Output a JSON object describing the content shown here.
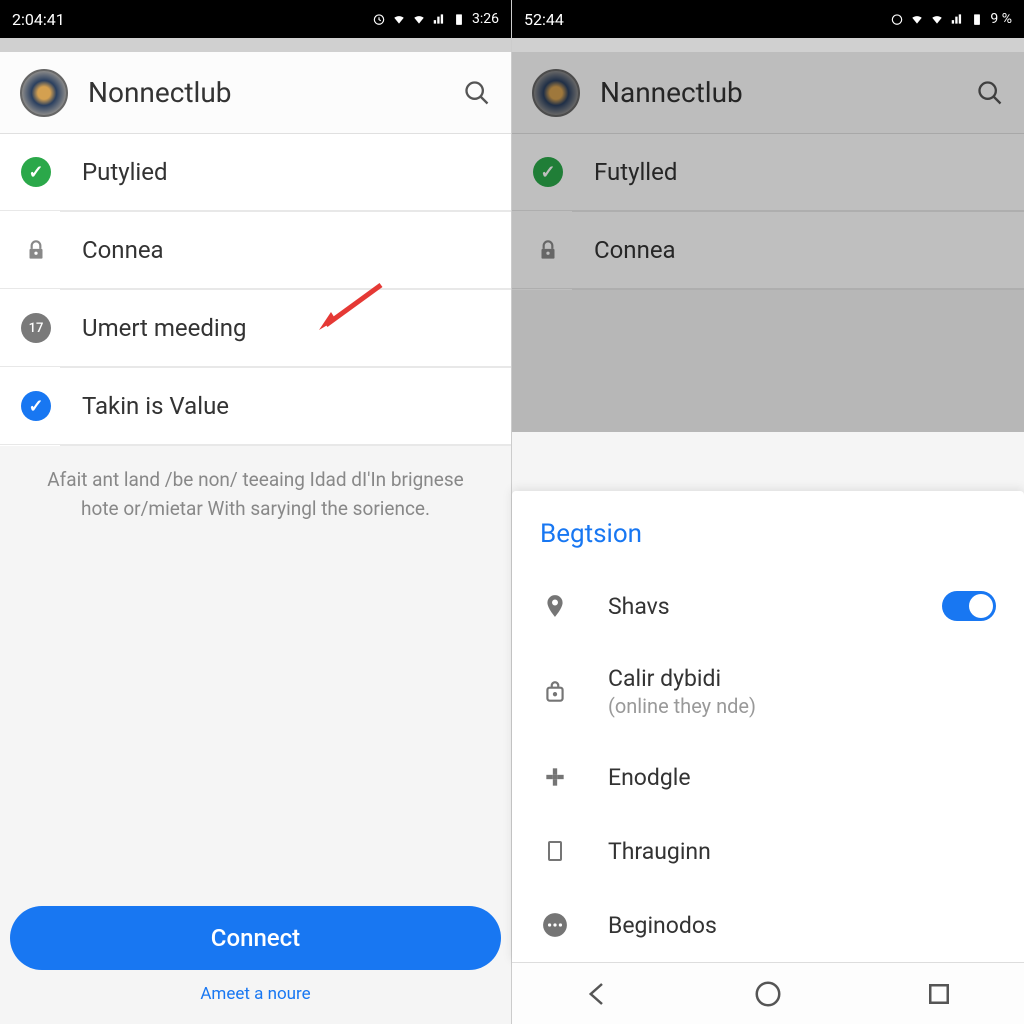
{
  "left": {
    "status": {
      "time": "2:04:41",
      "right_text": "3:26"
    },
    "header": {
      "title": "Nonnectlub"
    },
    "items": [
      {
        "icon": "check-green",
        "label": "Putylied"
      },
      {
        "icon": "lock",
        "label": "Connea"
      },
      {
        "icon": "badge",
        "badge_text": "17",
        "label": "Umert meeding"
      },
      {
        "icon": "check-blue",
        "label": "Takin is Value"
      }
    ],
    "description": "Afait ant land /be non/ teeaing Idad dI'In brignese hote or/mietar With saryingl the sorience.",
    "connect_label": "Connect",
    "bottom_link": "Ameet a noure"
  },
  "right": {
    "status": {
      "time": "52:44",
      "right_text": "9 %"
    },
    "header": {
      "title": "Nannectlub"
    },
    "items": [
      {
        "icon": "check-green",
        "label": "Futylled"
      },
      {
        "icon": "lock",
        "label": "Connea"
      }
    ],
    "sheet": {
      "title": "Begtsion",
      "items": [
        {
          "icon": "pin",
          "label": "Shavs",
          "toggle": true
        },
        {
          "icon": "bag",
          "label": "Calir dybidi",
          "sub": "(online they nde)"
        },
        {
          "icon": "hash",
          "label": "Enodgle"
        },
        {
          "icon": "phone",
          "label": "Thrauginn"
        },
        {
          "icon": "dots",
          "label": "Beginodos"
        }
      ]
    }
  }
}
